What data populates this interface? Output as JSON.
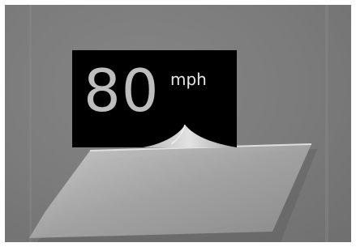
{
  "sign": {
    "speed_value": "80",
    "speed_unit": "mph"
  },
  "colors": {
    "background": "#7d7d7d",
    "sign_panel": "#000000",
    "sign_digits": "#bdbdbd",
    "curl": "#d0d0d0"
  }
}
